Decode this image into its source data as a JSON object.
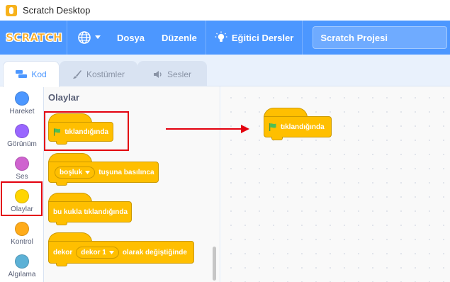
{
  "window": {
    "title": "Scratch Desktop"
  },
  "menubar": {
    "logo_text": "SCRATCH",
    "file": "Dosya",
    "edit": "Düzenle",
    "tutorials": "Eğitici Dersler",
    "project_title": "Scratch Projesi"
  },
  "tabs": {
    "code": "Kod",
    "costumes": "Kostümler",
    "sounds": "Sesler"
  },
  "categories": [
    {
      "label": "Hareket",
      "color": "#4c97ff"
    },
    {
      "label": "Görünüm",
      "color": "#9966ff"
    },
    {
      "label": "Ses",
      "color": "#cf63cf"
    },
    {
      "label": "Olaylar",
      "color": "#ffd500"
    },
    {
      "label": "Kontrol",
      "color": "#ffab19"
    },
    {
      "label": "Algılama",
      "color": "#5cb1d6"
    }
  ],
  "palette": {
    "heading": "Olaylar",
    "flag_block": "tıklandığında",
    "key_block": {
      "key": "boşluk",
      "text": "tuşuna basılınca"
    },
    "sprite_block": "bu kukla tıklandığında",
    "backdrop_block": {
      "prefix": "dekor",
      "value": "dekor 1",
      "suffix": "olarak değiştiğinde"
    }
  },
  "canvas": {
    "flag_block": "tıklandığında"
  },
  "colors": {
    "accent": "#4c97ff",
    "events": "#ffbf00",
    "highlight": "#e3000e",
    "flag": "#4cbf56"
  }
}
